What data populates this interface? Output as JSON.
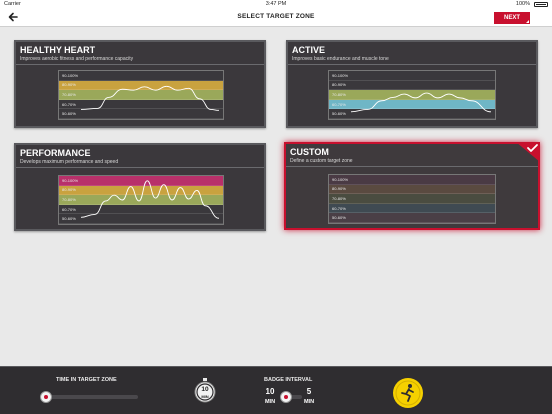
{
  "status_bar": {
    "carrier": "Carrier",
    "time": "3:47 PM",
    "battery": "100%"
  },
  "nav": {
    "back_icon": "arrow-left-icon",
    "title": "SELECT TARGET ZONE",
    "next_label": "NEXT"
  },
  "zone_labels": [
    "90-100%",
    "80-90%",
    "70-80%",
    "60-70%",
    "50-60%"
  ],
  "cards": [
    {
      "title": "HEALTHY HEART",
      "subtitle": "Improves aerobic fitness and performance capacity",
      "highlight_zones": [
        1,
        2
      ],
      "colors": [
        "#3a383c",
        "#c9a23f",
        "#9aa85a",
        "#3a383c",
        "#3a383c"
      ]
    },
    {
      "title": "ACTIVE",
      "subtitle": "Improves basic endurance and muscle tone",
      "highlight_zones": [
        2,
        3
      ],
      "colors": [
        "#3a383c",
        "#3a383c",
        "#9aa85a",
        "#6fb6c6",
        "#3a383c"
      ]
    },
    {
      "title": "PERFORMANCE",
      "subtitle": "Develops maximum performance and speed",
      "highlight_zones": [
        0,
        1,
        2
      ],
      "colors": [
        "#b8306a",
        "#c9a23f",
        "#9aa85a",
        "#3a383c",
        "#3a383c"
      ]
    },
    {
      "title": "CUSTOM",
      "subtitle": "Define a custom target zone",
      "selected": true,
      "colors": [
        "#4a3a44",
        "#5a4a40",
        "#4a4c40",
        "#3f4a52",
        "#4a3f46"
      ]
    }
  ],
  "bottom": {
    "time_label": "TIME IN TARGET ZONE",
    "time_slider_value": 0,
    "timer_value": "10",
    "timer_unit": "MIN",
    "badge_label": "BADGE INTERVAL",
    "badge_min_value": "10",
    "badge_min_unit": "MIN",
    "badge_max_value": "5",
    "badge_max_unit": "MIN",
    "medal_icon": "runner-medal-icon"
  },
  "colors": {
    "accent": "#c8102e",
    "medal": "#f5d000"
  }
}
